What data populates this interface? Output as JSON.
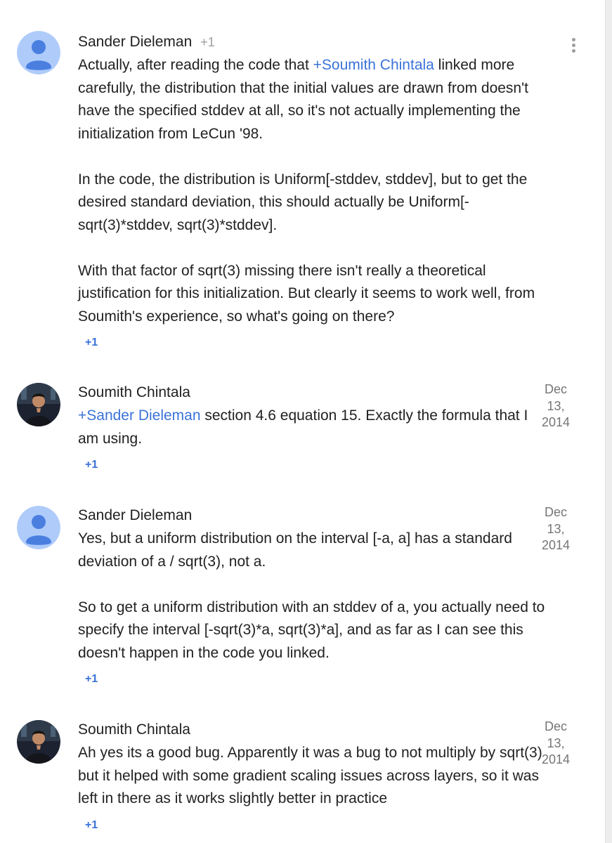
{
  "comments": [
    {
      "author": "Sander Dieleman",
      "plus_count": "+1",
      "mention": "+Soumith Chintala",
      "para1_before": "Actually, after reading the code that ",
      "para1_after": " linked more carefully, the distribution that the initial values are drawn from doesn't have the specified stddev at all, so it's not actually implementing the initialization from LeCun '98.",
      "para2": "In the code, the distribution is Uniform[-stddev, stddev], but to get the desired standard deviation, this should actually be Uniform[-sqrt(3)*stddev, sqrt(3)*stddev].",
      "para3": "With that factor of sqrt(3) missing there isn't really a theoretical justification for this initialization. But clearly it seems to work well, from Soumith's experience, so what's going on there?",
      "plus_one": "+1"
    },
    {
      "author": "Soumith Chintala",
      "mention": "+Sander Dieleman",
      "text_after": " section 4.6 equation 15. Exactly the formula that I am using.",
      "date_line1": "Dec",
      "date_line2": "13,",
      "date_line3": "2014",
      "plus_one": "+1"
    },
    {
      "author": "Sander Dieleman",
      "para1": "Yes, but a uniform distribution on the interval [-a, a] has a standard deviation of a / sqrt(3), not a.",
      "para2": "So to get a uniform distribution with an stddev of a, you actually need to specify the interval [-sqrt(3)*a, sqrt(3)*a], and as far as I can see this doesn't happen in the code you linked.",
      "date_line1": "Dec",
      "date_line2": "13,",
      "date_line3": "2014",
      "plus_one": "+1"
    },
    {
      "author": "Soumith Chintala",
      "text": "Ah yes its a good bug. Apparently it was a bug to not multiply by sqrt(3) but it helped with some gradient scaling issues across layers, so it was left in there as it works slightly better in practice",
      "date_line1": "Dec",
      "date_line2": "13,",
      "date_line3": "2014",
      "plus_one": "+1"
    }
  ],
  "icons": {
    "menu": "more-vert-icon",
    "default_avatar": "person-silhouette",
    "photo_avatar": "profile-photo"
  },
  "colors": {
    "link": "#3a73d9",
    "avatar_bg": "#aecbfa",
    "avatar_fg": "#4a7fe0",
    "meta": "#757575"
  }
}
